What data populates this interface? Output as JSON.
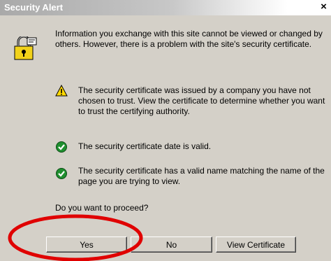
{
  "window": {
    "title": "Security Alert",
    "close_label": "×"
  },
  "dialog": {
    "intro": "Information you exchange with this site cannot be viewed or changed by others. However, there is a problem with the site's security certificate.",
    "items": [
      {
        "icon": "warning-icon",
        "text": "The security certificate was issued by a company you have not chosen to trust. View the certificate to determine whether you want to trust the certifying authority."
      },
      {
        "icon": "check-icon",
        "text": "The security certificate date is valid."
      },
      {
        "icon": "check-icon",
        "text": "The security certificate has a valid name matching the name of the page you are trying to view."
      }
    ],
    "question": "Do you want to proceed?"
  },
  "buttons": {
    "yes": "Yes",
    "no": "No",
    "view_certificate": "View Certificate"
  },
  "colors": {
    "highlight_ring": "#e00000",
    "check_green": "#1f8f2f",
    "warning_yellow": "#ffd800"
  }
}
